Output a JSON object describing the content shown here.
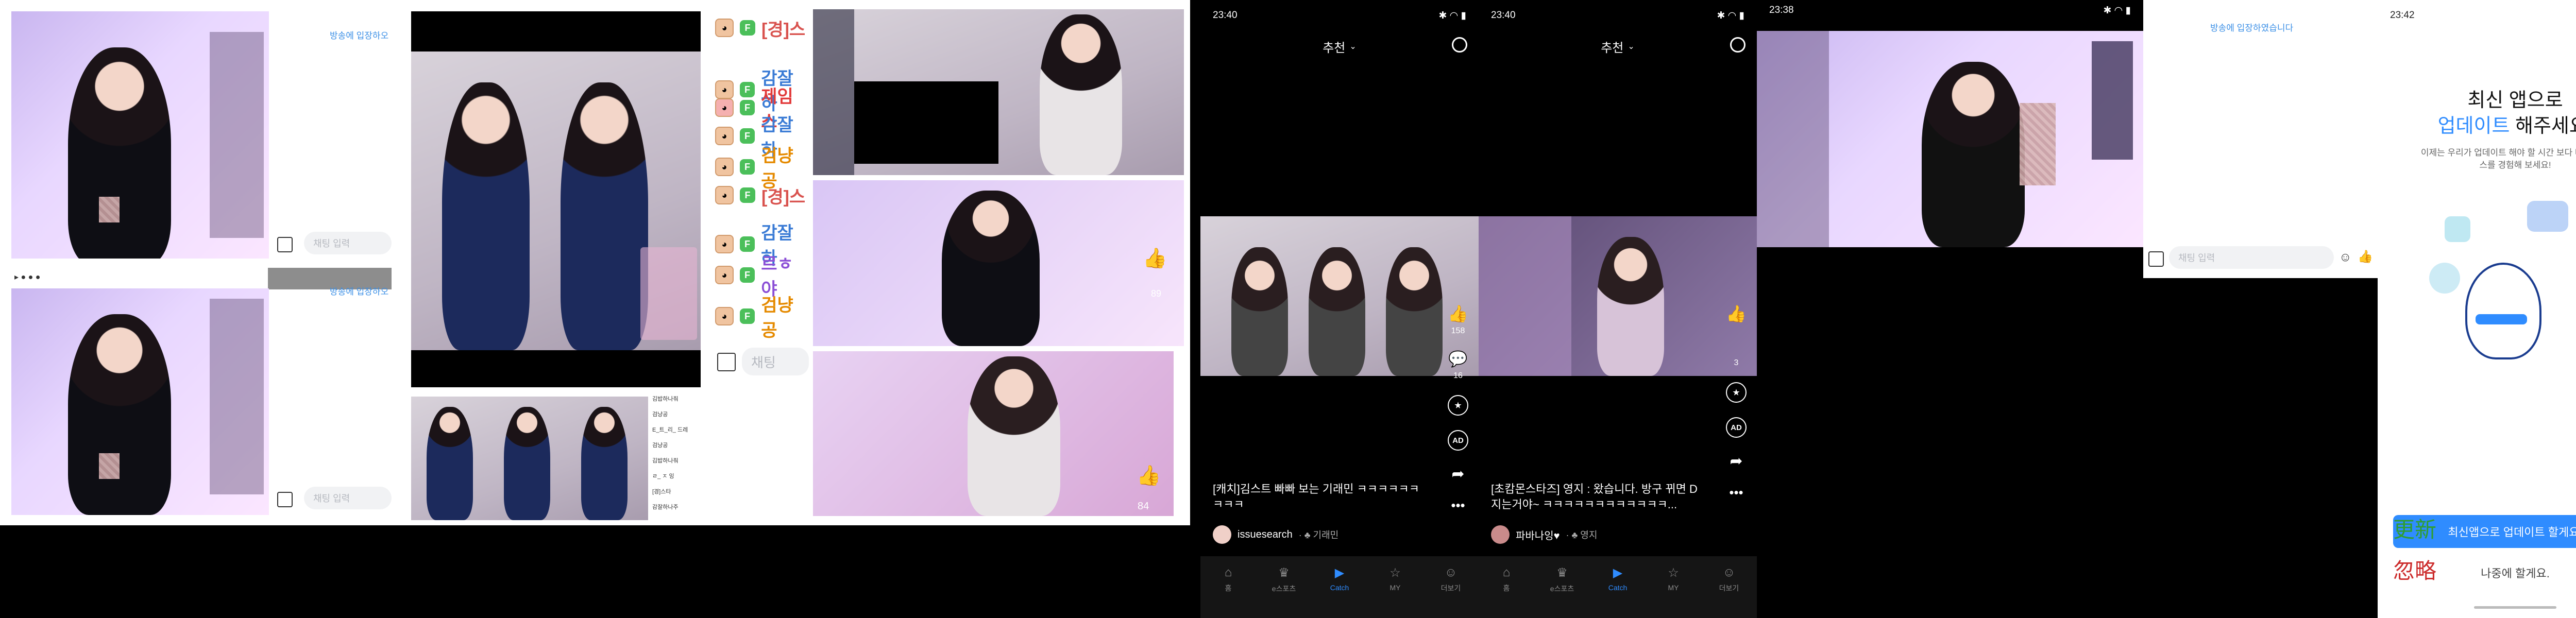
{
  "panel1": {
    "notice_top": "방송에 입장하오",
    "notice_mid": "방송에 입장하오",
    "chat_placeholder_top": "채팅 입력",
    "chat_placeholder_bottom": "채팅 입력"
  },
  "panel3": {
    "chat_rows": [
      {
        "name": "[경]스",
        "color": "#d9534f"
      },
      {
        "name": "감잘하",
        "color": "#3a7bd5"
      },
      {
        "name": "제임스",
        "color": "#e23a3a"
      },
      {
        "name": "감잘하",
        "color": "#3a7bd5"
      },
      {
        "name": "검냥공",
        "color": "#e58a00"
      },
      {
        "name": "[경]스",
        "color": "#d9534f"
      },
      {
        "name": "감잘하",
        "color": "#3a7bd5"
      },
      {
        "name": "르ㅎ야",
        "color": "#8b4fd6"
      },
      {
        "name": "검냥공",
        "color": "#e58a00"
      }
    ],
    "badge": "F",
    "chat_placeholder": "채팅",
    "list_items": [
      "김밥하나줘",
      "검냥공",
      "E_트_리_ 드레",
      "검냥공",
      "김밥하나줘",
      "ㄹ_ ㅈ 잉",
      "[경]스타",
      "감잘하나주"
    ]
  },
  "panel4": {
    "likes_bottom": "84",
    "likes_mid": "89"
  },
  "feed_common": {
    "header_title": "추천",
    "tabs": [
      {
        "label": "홈",
        "icon": "home-icon"
      },
      {
        "label": "e스포츠",
        "icon": "trophy-icon"
      },
      {
        "label": "Catch",
        "icon": "play-icon"
      },
      {
        "label": "MY",
        "icon": "star-icon"
      },
      {
        "label": "더보기",
        "icon": "person-icon"
      }
    ],
    "ad_label": "AD"
  },
  "feed1": {
    "time": "23:40",
    "like_count": "158",
    "comment_count": "16",
    "caption": "[캐치]김스트 빠빠 보는 기래민 ㅋㅋㅋㅋㅋㅋㅋㅋㅋ",
    "author": "issuesearch",
    "tag": "· ♣ 기래민"
  },
  "feed2": {
    "time": "23:40",
    "comment_count": "3",
    "caption": "[초캄몬스타즈] 영지 : 왔습니다. 방구 뀌면 D지는거야~ ㅋㅋㅋㅋㅋㅋㅋㅋㅋㅋㅋㅋ...",
    "author": "파바나잉♥",
    "tag": "· ♣ 영지"
  },
  "panel7": {
    "time": "23:38",
    "notice": "방송에 입장하였습니다",
    "chat_placeholder": "채팅 입력"
  },
  "update": {
    "time": "23:42",
    "title_line1": "최신 앱으로",
    "title_line2_accent": "업데이트",
    "title_line2_rest": " 해주세요.",
    "description": "이제는 우리가 업데이트 해야 할 시간 보다 나은 서비스를 경험해 보세요!",
    "primary_button": "최신앱으로 업데이트 할게요.",
    "secondary_button": "나중에 할게요.",
    "overlay_left": "更新",
    "overlay_left_2": "忽略"
  },
  "colors": {
    "accent_blue": "#2f8cff",
    "live_purple": "#c9b6f0",
    "dark_bg": "#000000"
  }
}
